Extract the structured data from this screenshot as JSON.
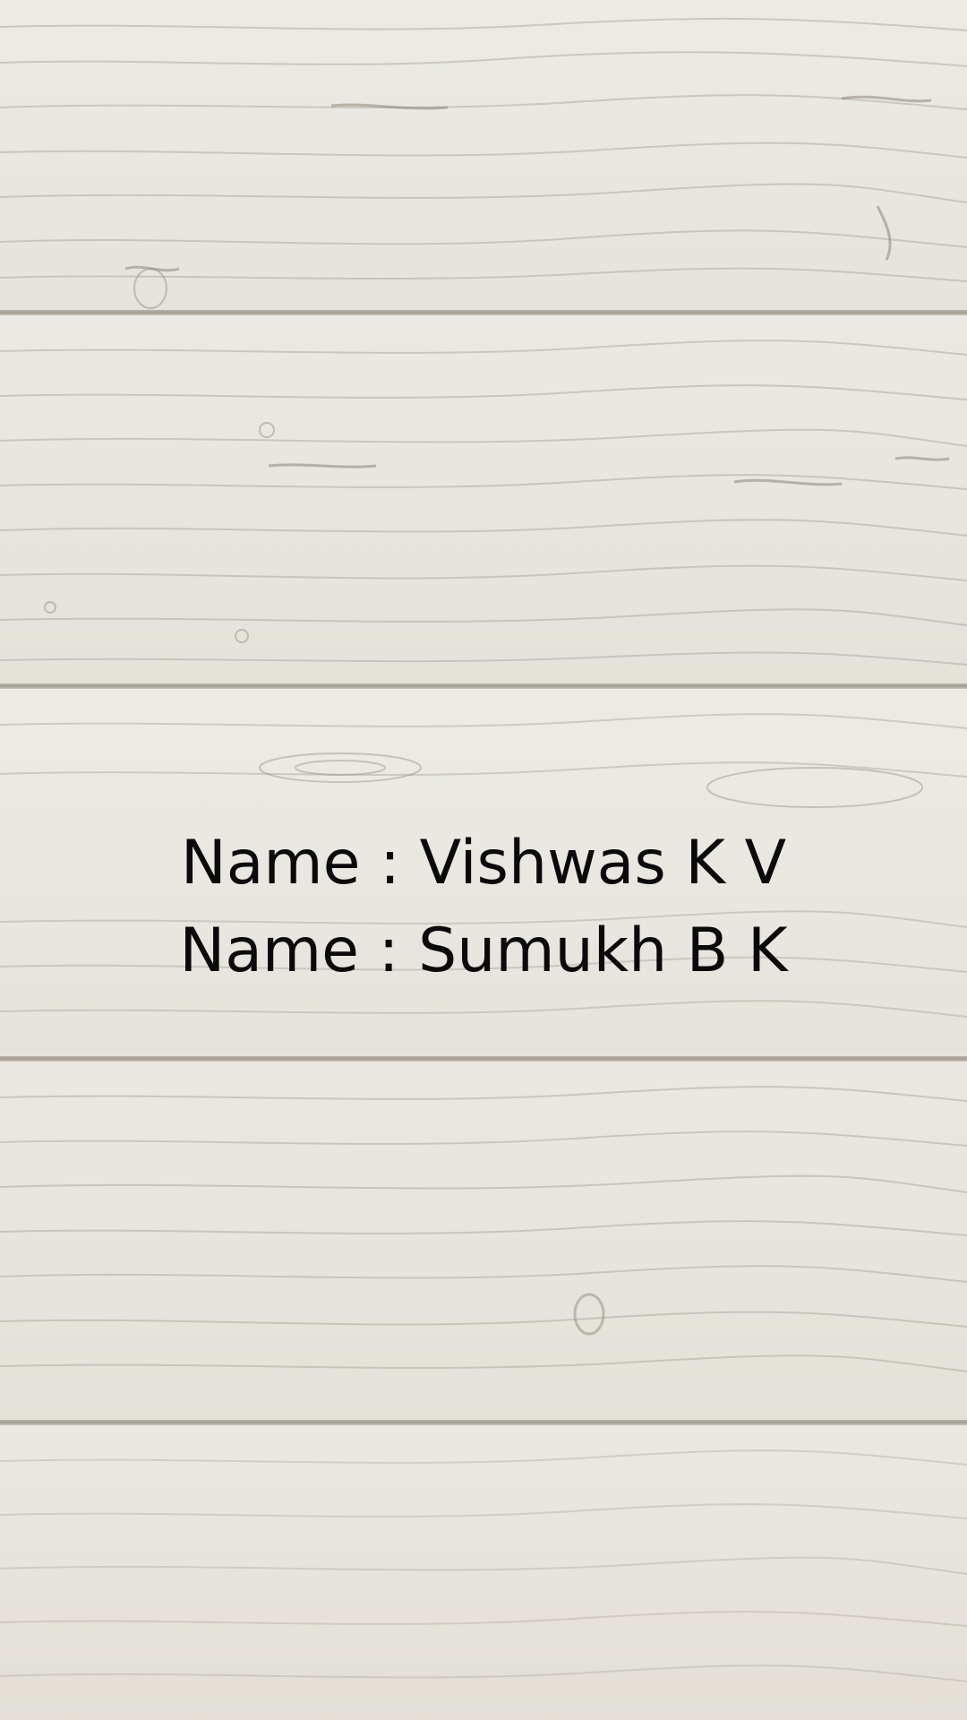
{
  "screen": {
    "background": "whitewashed-wood-planks",
    "text_color": "#0a0a0a"
  },
  "credits": {
    "line1": "Name : Vishwas K V",
    "line2": "Name : Sumukh B K"
  }
}
